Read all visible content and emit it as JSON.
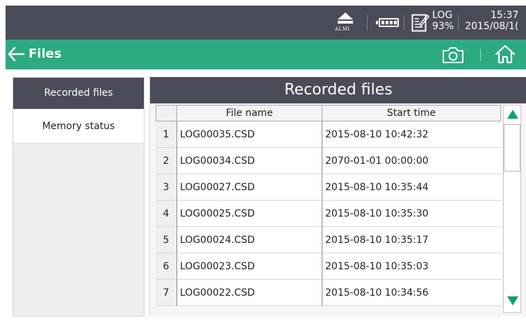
{
  "status": {
    "alarm_label": "ALMI",
    "log_label": "LOG",
    "log_percent": "93%",
    "time": "15:37",
    "date": "2015/08/1("
  },
  "titlebar": {
    "title": "Files"
  },
  "sidebar": {
    "items": [
      {
        "label": "Recorded files",
        "selected": true
      },
      {
        "label": "Memory status",
        "selected": false
      }
    ]
  },
  "panel": {
    "title": "Recorded files",
    "columns": {
      "name": "File name",
      "time": "Start time"
    },
    "rows": [
      {
        "idx": "1",
        "name": "LOG00035.CSD",
        "time": "2015-08-10 10:42:32"
      },
      {
        "idx": "2",
        "name": "LOG00034.CSD",
        "time": "2070-01-01 00:00:00"
      },
      {
        "idx": "3",
        "name": "LOG00027.CSD",
        "time": "2015-08-10 10:35:44"
      },
      {
        "idx": "4",
        "name": "LOG00025.CSD",
        "time": "2015-08-10 10:35:30"
      },
      {
        "idx": "5",
        "name": "LOG00024.CSD",
        "time": "2015-08-10 10:35:17"
      },
      {
        "idx": "6",
        "name": "LOG00023.CSD",
        "time": "2015-08-10 10:35:03"
      },
      {
        "idx": "7",
        "name": "LOG00022.CSD",
        "time": "2015-08-10 10:34:56"
      }
    ]
  },
  "colors": {
    "header_dark": "#4a4d59",
    "accent_green": "#2bab7f",
    "scroll_arrow": "#11a06a"
  },
  "icons": [
    "alarm-icon",
    "battery-icon",
    "log-icon",
    "back-arrow-icon",
    "camera-icon",
    "home-icon",
    "scroll-up-icon",
    "scroll-down-icon"
  ]
}
